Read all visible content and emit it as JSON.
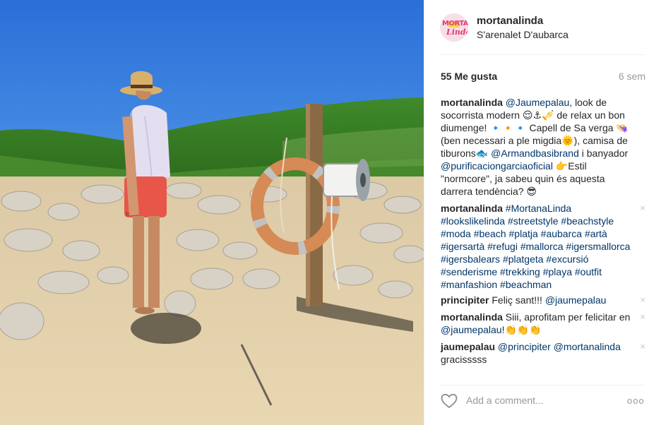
{
  "post": {
    "username": "mortanalinda",
    "location": "S'arenalet D'aubarca",
    "avatar_text_top": "MORTA",
    "avatar_text_bottom": "Linda",
    "likes": "55 Me gusta",
    "age": "6 sem"
  },
  "comments": [
    {
      "user": "mortanalinda",
      "link1": "@Jaumepalau",
      "text1": ", look de socorrista modern 😌⚓🎺 de relax un bon diumenge! 🔹🔸🔹 Capell de Sa verga 👒 (ben necessari a ple migdia🌞), camisa de tiburons🐟 ",
      "link2": "@Armandbasibrand",
      "text2": " i banyador ",
      "link3": "@purificaciongarciaoficial",
      "text3": " 👉Estil \"normcore\", ja sabeu quin és aquesta darrera tendència? 😎"
    },
    {
      "user": "mortanalinda",
      "tags": "#MortanaLinda #lookslikelinda #streetstyle #beachstyle #moda #beach #platja #aubarca #artà #igersartà #refugi #mallorca #igersmallorca #igersbalears #platgeta #excursió #senderisme #trekking #playa #outfit #manfashion #beachman",
      "close": "×"
    },
    {
      "user": "principiter",
      "text": "Feliç sant!!! ",
      "link": "@jaumepalau",
      "close": "×"
    },
    {
      "user": "mortanalinda",
      "text": "Siii, aprofitam per felicitar en ",
      "link": "@jaumepalau",
      "text_end": "!👏👏👏",
      "close": "×"
    },
    {
      "user": "jaumepalau",
      "link1": "@principiter",
      "link2": "@mortanalinda",
      "text_end": "gracisssss",
      "close": "×"
    }
  ],
  "footer": {
    "heart_icon": "heart-outline-icon",
    "placeholder": "Add a comment...",
    "more_label": "ooo"
  },
  "colors": {
    "link": "#003569",
    "muted": "#999999",
    "sky_top": "#2f79e0",
    "sky_bottom": "#8cc2f0",
    "sand": "#e6d4b0",
    "shorts": "#e8564a"
  }
}
